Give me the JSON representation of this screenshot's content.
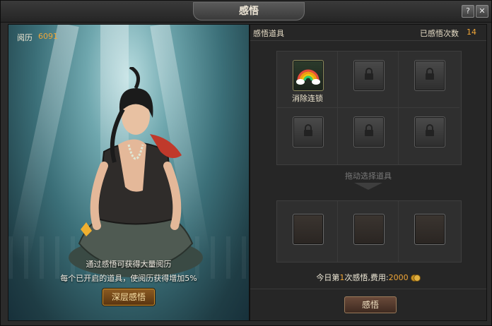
{
  "window": {
    "title": "感悟",
    "help_label": "?",
    "close_label": "✕"
  },
  "left": {
    "exp_label": "阅历",
    "exp_value": "6091",
    "hint_line1": "通过感悟可获得大量阅历",
    "hint_line2": "每个已开启的道具，使阅历获得增加5%",
    "deep_button": "深层感悟"
  },
  "right": {
    "items_title": "感悟道具",
    "count_label": "已感悟次数",
    "count_value": "14",
    "slots": [
      {
        "state": "unlocked",
        "name": "消除连锁",
        "icon": "rainbow-icon"
      },
      {
        "state": "locked",
        "icon": "lock-icon"
      },
      {
        "state": "locked",
        "icon": "lock-icon"
      },
      {
        "state": "locked",
        "icon": "lock-icon"
      },
      {
        "state": "locked",
        "icon": "lock-icon"
      },
      {
        "state": "locked",
        "icon": "lock-icon"
      }
    ],
    "drag_label": "拖动选择道具",
    "cost_prefix": "今日第",
    "cost_times": "1",
    "cost_middle": "次感悟,费用:",
    "cost_value": "2000",
    "gain_button": "感悟"
  },
  "colors": {
    "accent": "#f0a637",
    "text": "#f0ead8"
  }
}
